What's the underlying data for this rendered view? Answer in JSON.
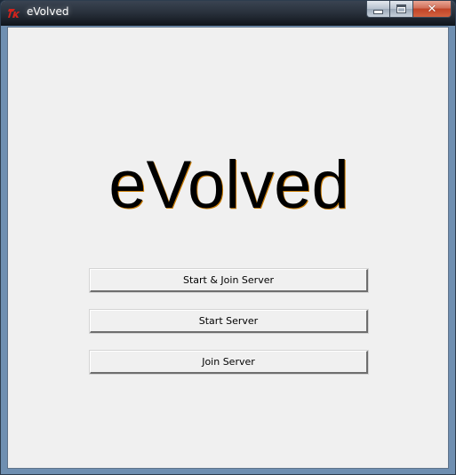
{
  "window": {
    "title": "eVolved",
    "icon": "tk-feather-icon",
    "controls": {
      "minimize": "minimize-icon",
      "maximize": "maximize-icon",
      "close_glyph": "✕"
    }
  },
  "main": {
    "title": "eVolved",
    "buttons": [
      {
        "label": "Start & Join Server"
      },
      {
        "label": "Start Server"
      },
      {
        "label": "Join Server"
      }
    ]
  },
  "colors": {
    "titlebar": "#2a323d",
    "close_button": "#c04427",
    "client_background": "#f0f0f0",
    "title_shadow": "#c77a00"
  }
}
